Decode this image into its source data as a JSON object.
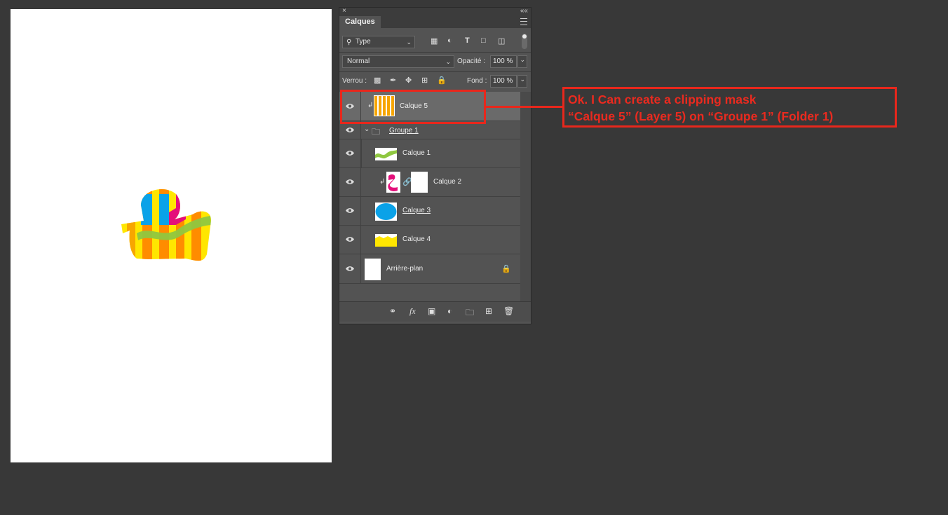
{
  "panel": {
    "close_label": "×",
    "collapse_label": "««",
    "tab_label": "Calques",
    "filter": {
      "value": "Type"
    },
    "blend_mode": "Normal",
    "opacity_label": "Opacité :",
    "opacity_value": "100 %",
    "lock_label": "Verrou :",
    "fill_label": "Fond :",
    "fill_value": "100 %"
  },
  "layers": [
    {
      "name": "Calque 5",
      "selected": true,
      "clipped": true
    },
    {
      "name": "Groupe 1",
      "type": "group",
      "expanded": true
    },
    {
      "name": "Calque 1"
    },
    {
      "name": "Calque 2",
      "clipped": true,
      "has_mask": true
    },
    {
      "name": "Calque 3",
      "underlined": true
    },
    {
      "name": "Calque 4"
    },
    {
      "name": "Arrière-plan",
      "locked": true
    }
  ],
  "annotation": {
    "line1": "Ok. I Can create a clipping mask",
    "line2": "“Calque 5” (Layer 5) on “Groupe 1” (Folder 1)",
    "color": "#e8271c"
  },
  "colors": {
    "workspace": "#383838",
    "panel": "#535353",
    "selected_row": "#6a6a6a"
  }
}
